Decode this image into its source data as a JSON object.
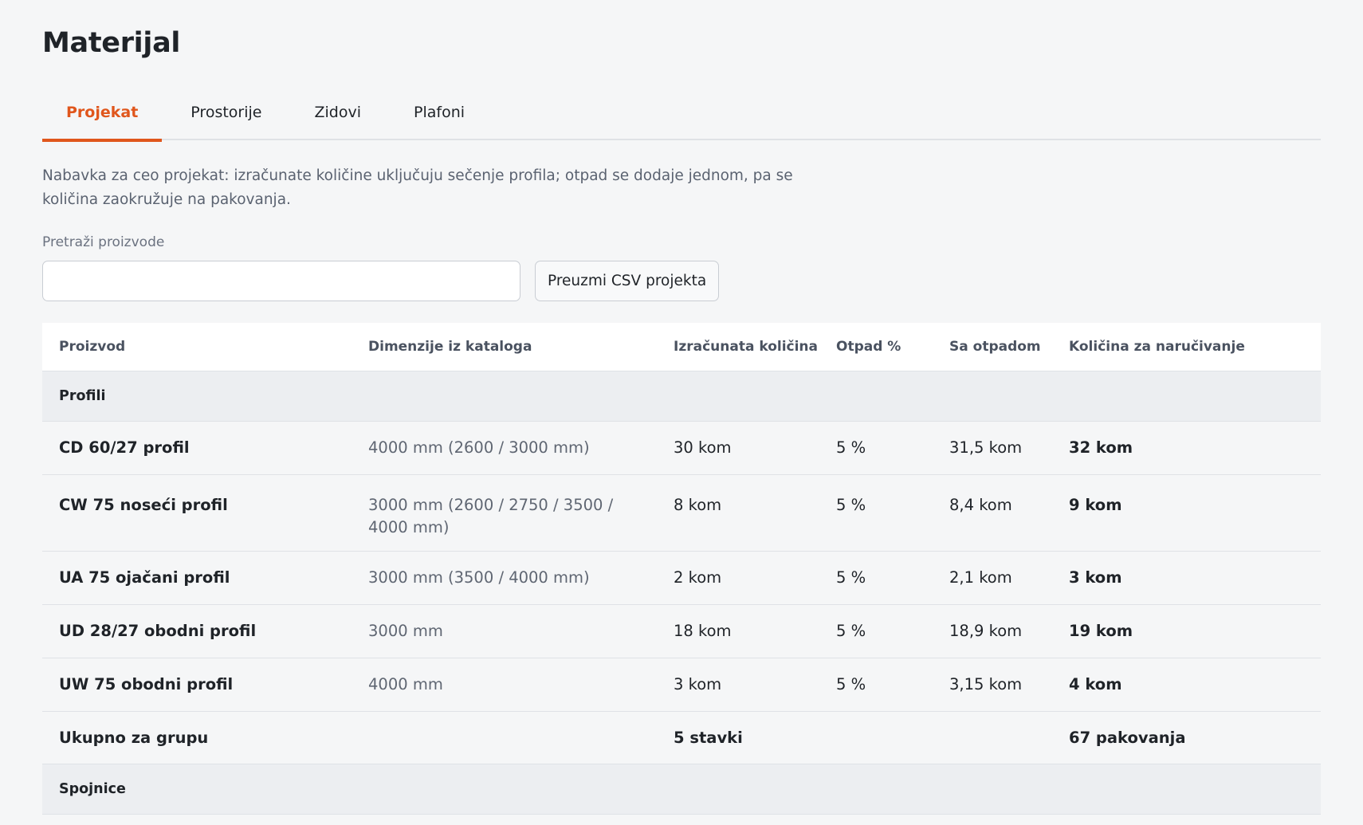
{
  "page": {
    "title": "Materijal"
  },
  "tabs": [
    {
      "label": "Projekat",
      "active": true
    },
    {
      "label": "Prostorije",
      "active": false
    },
    {
      "label": "Zidovi",
      "active": false
    },
    {
      "label": "Plafoni",
      "active": false
    }
  ],
  "description": "Nabavka za ceo projekat: izračunate količine uključuju sečenje profila; otpad se dodaje jednom, pa se količina zaokružuje na pakovanja.",
  "search": {
    "label": "Pretraži proizvode",
    "value": "",
    "placeholder": ""
  },
  "csv_button": {
    "label": "Preuzmi CSV projekta"
  },
  "table": {
    "headers": [
      "Proizvod",
      "Dimenzije iz kataloga",
      "Izračunata količina",
      "Otpad %",
      "Sa otpadom",
      "Količina za naručivanje"
    ],
    "groups": [
      {
        "name": "Profili",
        "rows": [
          {
            "product": "CD 60/27 profil",
            "dimensions": "4000 mm (2600 / 3000 mm)",
            "calculated": "30 kom",
            "waste": "5 %",
            "with_waste": "31,5 kom",
            "order": "32 kom"
          },
          {
            "product": "CW 75 noseći profil",
            "dimensions": "3000 mm (2600 / 2750 / 3500 / 4000 mm)",
            "calculated": "8 kom",
            "waste": "5 %",
            "with_waste": "8,4 kom",
            "order": "9 kom"
          },
          {
            "product": "UA 75 ojačani profil",
            "dimensions": "3000 mm (3500 / 4000 mm)",
            "calculated": "2 kom",
            "waste": "5 %",
            "with_waste": "2,1 kom",
            "order": "3 kom"
          },
          {
            "product": "UD 28/27 obodni profil",
            "dimensions": "3000 mm",
            "calculated": "18 kom",
            "waste": "5 %",
            "with_waste": "18,9 kom",
            "order": "19 kom"
          },
          {
            "product": "UW 75 obodni profil",
            "dimensions": "4000 mm",
            "calculated": "3 kom",
            "waste": "5 %",
            "with_waste": "3,15 kom",
            "order": "4 kom"
          }
        ],
        "total": {
          "label": "Ukupno za grupu",
          "items": "5 stavki",
          "packages": "67 pakovanja"
        }
      },
      {
        "name": "Spojnice",
        "rows": []
      }
    ]
  },
  "colors": {
    "accent": "#e0561c",
    "background": "#f5f6f7",
    "group_background": "#eceef1"
  }
}
